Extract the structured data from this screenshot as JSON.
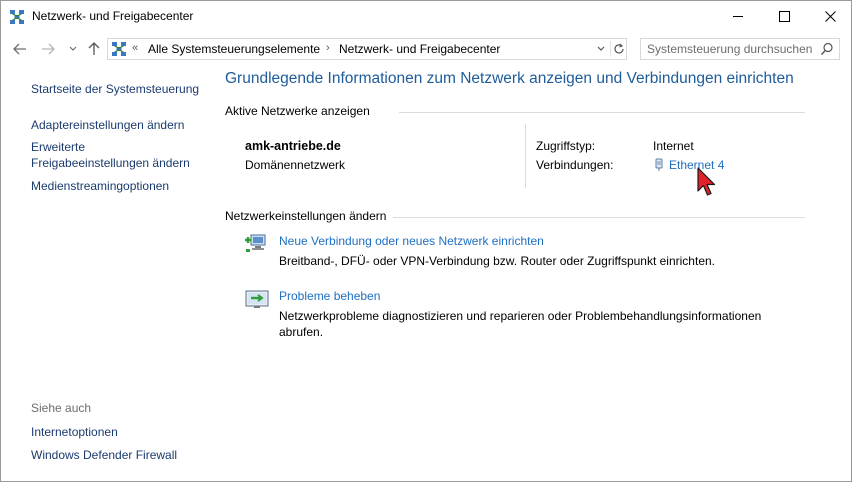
{
  "window": {
    "title": "Netzwerk- und Freigabecenter",
    "controls": {
      "minimize": "—",
      "maximize": "☐",
      "close": "✕"
    }
  },
  "navigation": {
    "back": "←",
    "forward": "→",
    "recent": "⌄",
    "up": "↑",
    "breadcrumb_overflow": "«",
    "breadcrumbs": [
      "Alle Systemsteuerungselemente",
      "Netzwerk- und Freigabecenter"
    ],
    "separator": "›",
    "dropdown": "⌄",
    "refresh": "↻",
    "search_placeholder": "Systemsteuerung durchsuchen"
  },
  "sidebar": {
    "home": "Startseite der Systemsteuerung",
    "items": [
      "Adaptereinstellungen ändern",
      "Erweiterte",
      "Freigabeeinstellungen ändern",
      "Medienstreamingoptionen"
    ],
    "see_also_label": "Siehe auch",
    "see_also": [
      "Internetoptionen",
      "Windows Defender Firewall"
    ]
  },
  "main": {
    "title": "Grundlegende Informationen zum Netzwerk anzeigen und Verbindungen einrichten",
    "active_networks_heading": "Aktive Netzwerke anzeigen",
    "network": {
      "name": "amk-antriebe.de",
      "category": "Domänennetzwerk",
      "access_type_label": "Zugriffstyp:",
      "access_type_value": "Internet",
      "connections_label": "Verbindungen:",
      "connection_name": "Ethernet 4"
    },
    "change_settings_heading": "Netzwerkeinstellungen ändern",
    "tasks": [
      {
        "icon": "network-setup-icon",
        "title": "Neue Verbindung oder neues Netzwerk einrichten",
        "description": "Breitband-, DFÜ- oder VPN-Verbindung bzw. Router oder Zugriffspunkt einrichten."
      },
      {
        "icon": "troubleshoot-icon",
        "title": "Probleme beheben",
        "description": "Netzwerkprobleme diagnostizieren und reparieren oder Problembehandlungsinformationen abrufen."
      }
    ]
  },
  "colors": {
    "link": "#1e6fc2",
    "title": "#1e5c9a",
    "nav_link": "#1b3b6f",
    "muted": "#6d6d6d",
    "cursor": "#e0222a"
  }
}
